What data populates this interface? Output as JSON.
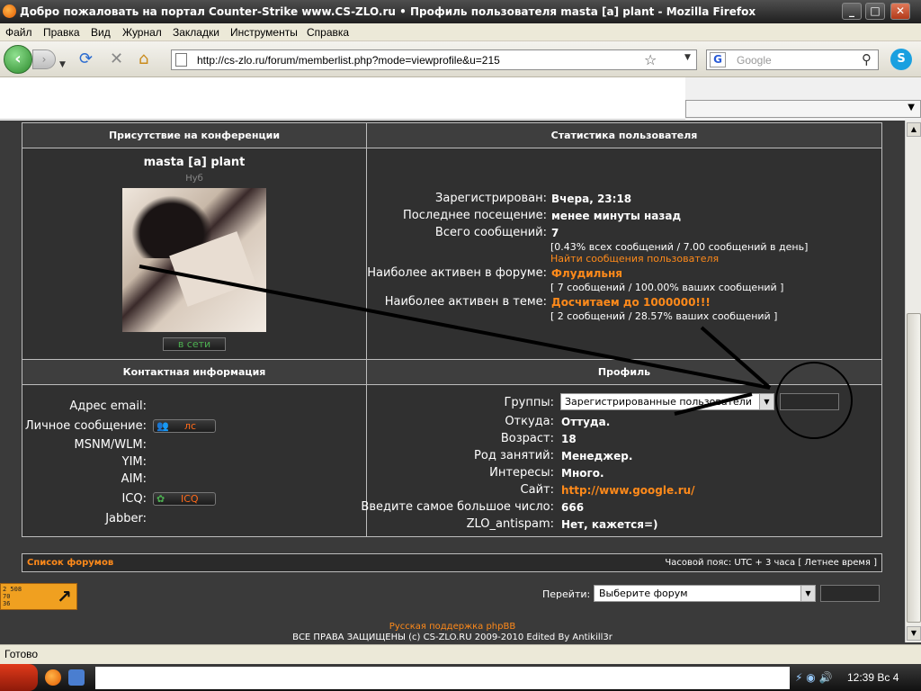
{
  "window": {
    "title": "Добро пожаловать на портал Counter-Strike www.CS-ZLO.ru • Профиль пользователя masta [a] plant - Mozilla Firefox",
    "min": "_",
    "max": "□",
    "close": "✕"
  },
  "menu": [
    "Файл",
    "Правка",
    "Вид",
    "Журнал",
    "Закладки",
    "Инструменты",
    "Справка"
  ],
  "nav": {
    "url": "http://cs-zlo.ru/forum/memberlist.php?mode=viewprofile&u=215",
    "search_placeholder": "Google"
  },
  "presence": {
    "header": "Присутствие на конференции",
    "username": "masta [a] plant",
    "rank": "Нуб",
    "status_button": "в сети"
  },
  "stats": {
    "header": "Статистика пользователя",
    "rows": [
      {
        "label": "Зарегистрирован:",
        "value": "Вчера, 23:18"
      },
      {
        "label": "Последнее посещение:",
        "value": "менее минуты назад"
      },
      {
        "label": "Всего сообщений:",
        "value": "7"
      }
    ],
    "posts_detail": "[0.43% всех сообщений / 7.00 сообщений в день]",
    "find_posts": "Найти сообщения пользователя",
    "active_forum_label": "Наиболее активен в форуме:",
    "active_forum": "Флудильня",
    "active_forum_detail": "[ 7 сообщений / 100.00% ваших сообщений ]",
    "active_topic_label": "Наиболее активен в теме:",
    "active_topic": "Досчитаем до 1000000!!!",
    "active_topic_detail": "[ 2 сообщений / 28.57% ваших сообщений ]"
  },
  "contact": {
    "header": "Контактная информация",
    "email": "Адрес email:",
    "pm": "Личное сообщение:",
    "pm_button": "лс",
    "msnm": "MSNM/WLM:",
    "yim": "YIM:",
    "aim": "AIM:",
    "icq": "ICQ:",
    "icq_button": "ICQ",
    "jabber": "Jabber:"
  },
  "profile": {
    "header": "Профиль",
    "groups_label": "Группы:",
    "groups_value": "Зарегистрированные пользователи",
    "rows": [
      {
        "label": "Откуда:",
        "value": "Оттуда."
      },
      {
        "label": "Возраст:",
        "value": "18"
      },
      {
        "label": "Род занятий:",
        "value": "Менеджер."
      },
      {
        "label": "Интересы:",
        "value": "Много."
      },
      {
        "label": "Сайт:",
        "value": "http://www.google.ru/"
      },
      {
        "label": "Введите самое большое число:",
        "value": "666"
      },
      {
        "label": "ZLO_antispam:",
        "value": "Нет, кажется=)"
      }
    ]
  },
  "footer": {
    "forum_list": "Список форумов",
    "timezone": "Часовой пояс: UTC + 3 часа [ Летнее время ]",
    "counter": [
      "2 508",
      "70",
      "36"
    ],
    "jump_label": "Перейти:",
    "jump_select": "Выберите форум",
    "support": "Русская поддержка phpBB",
    "copyright": "ВСЕ ПРАВА ЗАЩИЩЕНЫ (c) CS-ZLO.RU 2009-2010 Edited By Antikill3r"
  },
  "status": "Готово",
  "clock": "12:39 Вс 4"
}
